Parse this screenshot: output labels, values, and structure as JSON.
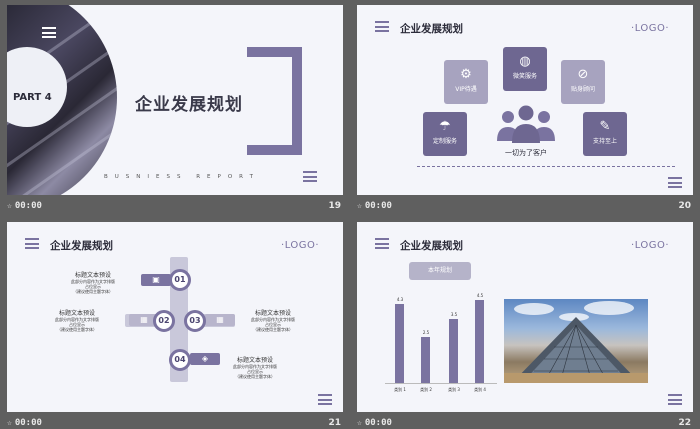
{
  "slides": {
    "s19": {
      "part_label": "PART 4",
      "title": "企业发展规划",
      "subtitle": "BUSNIESS REPORT",
      "time": "00:00",
      "number": "19"
    },
    "s20": {
      "title": "企业发展规划",
      "logo": "LOGO",
      "tiles": [
        "VIP待遇",
        "微笑服务",
        "贴身顾问",
        "定制服务",
        "支持至上"
      ],
      "center_caption": "一切为了客户",
      "time": "00:00",
      "number": "20"
    },
    "s21": {
      "title": "企业发展规划",
      "logo": "LOGO",
      "steps": [
        "01",
        "02",
        "03",
        "04"
      ],
      "text_heading": "标题文本预设",
      "text_body_1": "此部分内容作为文字排版",
      "text_body_2": "占位显示",
      "text_body_3": "（建议使用主题字体）",
      "time": "00:00",
      "number": "21"
    },
    "s22": {
      "title": "企业发展规划",
      "logo": "LOGO",
      "tag": "本年规划",
      "time": "00:00",
      "number": "22"
    }
  },
  "chart_data": {
    "type": "bar",
    "categories": [
      "类别 1",
      "类别 2",
      "类别 3",
      "类别 4"
    ],
    "values": [
      4.3,
      2.5,
      3.5,
      4.5
    ],
    "ylim": [
      0,
      5
    ],
    "title": "",
    "xlabel": "",
    "ylabel": "",
    "color": "#7a73a0"
  },
  "colors": {
    "accent": "#7a73a0",
    "accent_light": "#a7a3bf",
    "slide_bg": "#f4f5fa",
    "frame_bg": "#5f5f5f"
  }
}
